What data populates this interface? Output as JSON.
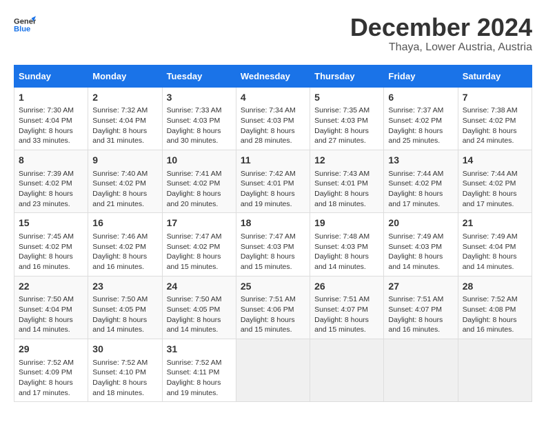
{
  "logo": {
    "line1": "General",
    "line2": "Blue"
  },
  "title": "December 2024",
  "subtitle": "Thaya, Lower Austria, Austria",
  "weekdays": [
    "Sunday",
    "Monday",
    "Tuesday",
    "Wednesday",
    "Thursday",
    "Friday",
    "Saturday"
  ],
  "weeks": [
    [
      {
        "day": "1",
        "lines": [
          "Sunrise: 7:30 AM",
          "Sunset: 4:04 PM",
          "Daylight: 8 hours",
          "and 33 minutes."
        ]
      },
      {
        "day": "2",
        "lines": [
          "Sunrise: 7:32 AM",
          "Sunset: 4:04 PM",
          "Daylight: 8 hours",
          "and 31 minutes."
        ]
      },
      {
        "day": "3",
        "lines": [
          "Sunrise: 7:33 AM",
          "Sunset: 4:03 PM",
          "Daylight: 8 hours",
          "and 30 minutes."
        ]
      },
      {
        "day": "4",
        "lines": [
          "Sunrise: 7:34 AM",
          "Sunset: 4:03 PM",
          "Daylight: 8 hours",
          "and 28 minutes."
        ]
      },
      {
        "day": "5",
        "lines": [
          "Sunrise: 7:35 AM",
          "Sunset: 4:03 PM",
          "Daylight: 8 hours",
          "and 27 minutes."
        ]
      },
      {
        "day": "6",
        "lines": [
          "Sunrise: 7:37 AM",
          "Sunset: 4:02 PM",
          "Daylight: 8 hours",
          "and 25 minutes."
        ]
      },
      {
        "day": "7",
        "lines": [
          "Sunrise: 7:38 AM",
          "Sunset: 4:02 PM",
          "Daylight: 8 hours",
          "and 24 minutes."
        ]
      }
    ],
    [
      {
        "day": "8",
        "lines": [
          "Sunrise: 7:39 AM",
          "Sunset: 4:02 PM",
          "Daylight: 8 hours",
          "and 23 minutes."
        ]
      },
      {
        "day": "9",
        "lines": [
          "Sunrise: 7:40 AM",
          "Sunset: 4:02 PM",
          "Daylight: 8 hours",
          "and 21 minutes."
        ]
      },
      {
        "day": "10",
        "lines": [
          "Sunrise: 7:41 AM",
          "Sunset: 4:02 PM",
          "Daylight: 8 hours",
          "and 20 minutes."
        ]
      },
      {
        "day": "11",
        "lines": [
          "Sunrise: 7:42 AM",
          "Sunset: 4:01 PM",
          "Daylight: 8 hours",
          "and 19 minutes."
        ]
      },
      {
        "day": "12",
        "lines": [
          "Sunrise: 7:43 AM",
          "Sunset: 4:01 PM",
          "Daylight: 8 hours",
          "and 18 minutes."
        ]
      },
      {
        "day": "13",
        "lines": [
          "Sunrise: 7:44 AM",
          "Sunset: 4:02 PM",
          "Daylight: 8 hours",
          "and 17 minutes."
        ]
      },
      {
        "day": "14",
        "lines": [
          "Sunrise: 7:44 AM",
          "Sunset: 4:02 PM",
          "Daylight: 8 hours",
          "and 17 minutes."
        ]
      }
    ],
    [
      {
        "day": "15",
        "lines": [
          "Sunrise: 7:45 AM",
          "Sunset: 4:02 PM",
          "Daylight: 8 hours",
          "and 16 minutes."
        ]
      },
      {
        "day": "16",
        "lines": [
          "Sunrise: 7:46 AM",
          "Sunset: 4:02 PM",
          "Daylight: 8 hours",
          "and 16 minutes."
        ]
      },
      {
        "day": "17",
        "lines": [
          "Sunrise: 7:47 AM",
          "Sunset: 4:02 PM",
          "Daylight: 8 hours",
          "and 15 minutes."
        ]
      },
      {
        "day": "18",
        "lines": [
          "Sunrise: 7:47 AM",
          "Sunset: 4:03 PM",
          "Daylight: 8 hours",
          "and 15 minutes."
        ]
      },
      {
        "day": "19",
        "lines": [
          "Sunrise: 7:48 AM",
          "Sunset: 4:03 PM",
          "Daylight: 8 hours",
          "and 14 minutes."
        ]
      },
      {
        "day": "20",
        "lines": [
          "Sunrise: 7:49 AM",
          "Sunset: 4:03 PM",
          "Daylight: 8 hours",
          "and 14 minutes."
        ]
      },
      {
        "day": "21",
        "lines": [
          "Sunrise: 7:49 AM",
          "Sunset: 4:04 PM",
          "Daylight: 8 hours",
          "and 14 minutes."
        ]
      }
    ],
    [
      {
        "day": "22",
        "lines": [
          "Sunrise: 7:50 AM",
          "Sunset: 4:04 PM",
          "Daylight: 8 hours",
          "and 14 minutes."
        ]
      },
      {
        "day": "23",
        "lines": [
          "Sunrise: 7:50 AM",
          "Sunset: 4:05 PM",
          "Daylight: 8 hours",
          "and 14 minutes."
        ]
      },
      {
        "day": "24",
        "lines": [
          "Sunrise: 7:50 AM",
          "Sunset: 4:05 PM",
          "Daylight: 8 hours",
          "and 14 minutes."
        ]
      },
      {
        "day": "25",
        "lines": [
          "Sunrise: 7:51 AM",
          "Sunset: 4:06 PM",
          "Daylight: 8 hours",
          "and 15 minutes."
        ]
      },
      {
        "day": "26",
        "lines": [
          "Sunrise: 7:51 AM",
          "Sunset: 4:07 PM",
          "Daylight: 8 hours",
          "and 15 minutes."
        ]
      },
      {
        "day": "27",
        "lines": [
          "Sunrise: 7:51 AM",
          "Sunset: 4:07 PM",
          "Daylight: 8 hours",
          "and 16 minutes."
        ]
      },
      {
        "day": "28",
        "lines": [
          "Sunrise: 7:52 AM",
          "Sunset: 4:08 PM",
          "Daylight: 8 hours",
          "and 16 minutes."
        ]
      }
    ],
    [
      {
        "day": "29",
        "lines": [
          "Sunrise: 7:52 AM",
          "Sunset: 4:09 PM",
          "Daylight: 8 hours",
          "and 17 minutes."
        ]
      },
      {
        "day": "30",
        "lines": [
          "Sunrise: 7:52 AM",
          "Sunset: 4:10 PM",
          "Daylight: 8 hours",
          "and 18 minutes."
        ]
      },
      {
        "day": "31",
        "lines": [
          "Sunrise: 7:52 AM",
          "Sunset: 4:11 PM",
          "Daylight: 8 hours",
          "and 19 minutes."
        ]
      },
      null,
      null,
      null,
      null
    ]
  ]
}
